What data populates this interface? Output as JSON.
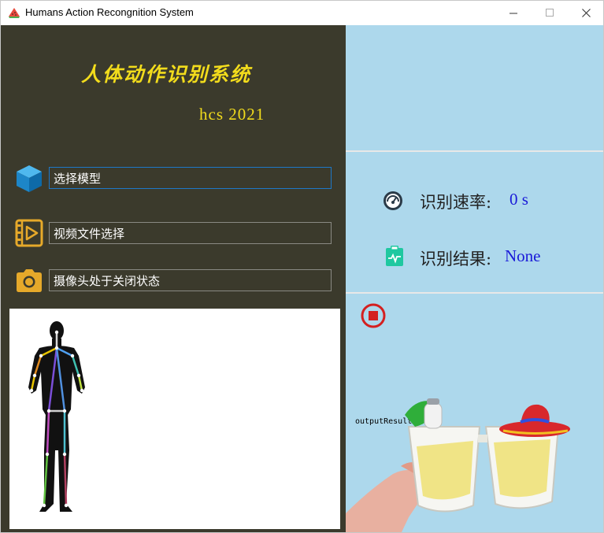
{
  "window": {
    "title": "Humans Action Recongnition System",
    "minimize_glyph": "—",
    "maximize_glyph": "☐",
    "close_glyph": "✕"
  },
  "left": {
    "main_title": "人体动作识别系统",
    "sub_title": "hcs 2021",
    "rows": [
      {
        "label": "选择模型",
        "icon": "cube-icon"
      },
      {
        "label": "视频文件选择",
        "icon": "video-file-icon"
      },
      {
        "label": "摄像头处于关闭状态",
        "icon": "camera-icon"
      }
    ]
  },
  "right": {
    "rate_label": "识别速率:",
    "rate_value": "0 s",
    "result_label": "识别结果:",
    "result_value": "None",
    "output_label": "outputResult"
  },
  "colors": {
    "left_bg": "#3b3a2c",
    "title_yellow": "#f2dc1c",
    "right_bg": "#add8ec",
    "value_blue": "#1a1ad8",
    "stop_red": "#d42020"
  }
}
